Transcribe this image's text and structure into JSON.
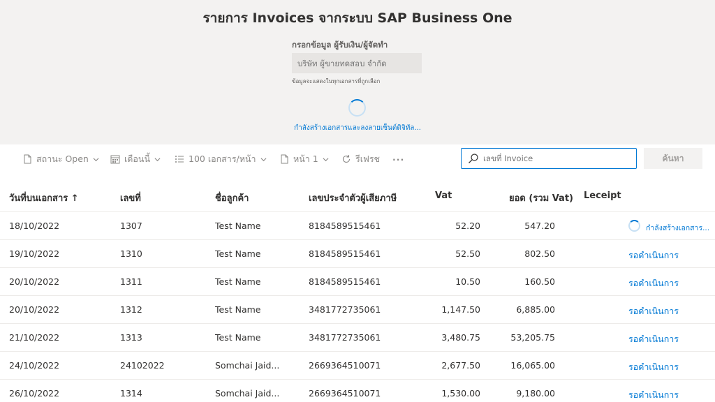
{
  "page": {
    "title": "รายการ Invoices จากระบบ SAP Business One"
  },
  "form": {
    "label": "กรอกข้อมูล ผู้รับเงิน/ผู้จัดทำ",
    "placeholder": "บริษัท ผู้ขายทดสอบ จำกัด",
    "hint": "ข้อมูลจะแสดงในทุกเอกสารที่ถูกเลือก",
    "status": "กำลังสร้างเอกสารและลงลายเซ็นต์ดิจิทัล..."
  },
  "toolbar": {
    "status_filter": "สถานะ Open",
    "date_filter": "เดือนนี้",
    "page_size": "100 เอกสาร/หน้า",
    "page": "หน้า 1",
    "refresh": "รีเฟรช",
    "more": "···",
    "search_placeholder": "เลขที่ Invoice",
    "search_button": "ค้นหา"
  },
  "table": {
    "columns": {
      "date": "วันที่บนเอกสาร ↑",
      "number": "เลขที่",
      "customer": "ชื่อลูกค้า",
      "taxid": "เลขประจำตัวผู้เสียภาษี",
      "vat": "Vat",
      "total": "ยอด (รวม Vat)",
      "receipt": "Leceipt"
    },
    "rows": [
      {
        "date": "18/10/2022",
        "number": "1307",
        "customer": "Test Name",
        "taxid": "8184589515461",
        "vat": "52.20",
        "total": "547.20",
        "receipt": "กำลังสร้างเอกสาร..."
      },
      {
        "date": "19/10/2022",
        "number": "1310",
        "customer": "Test Name",
        "taxid": "8184589515461",
        "vat": "52.50",
        "total": "802.50",
        "receipt": "รอดำเนินการ"
      },
      {
        "date": "20/10/2022",
        "number": "1311",
        "customer": "Test Name",
        "taxid": "8184589515461",
        "vat": "10.50",
        "total": "160.50",
        "receipt": "รอดำเนินการ"
      },
      {
        "date": "20/10/2022",
        "number": "1312",
        "customer": "Test Name",
        "taxid": "3481772735061",
        "vat": "1,147.50",
        "total": "6,885.00",
        "receipt": "รอดำเนินการ"
      },
      {
        "date": "21/10/2022",
        "number": "1313",
        "customer": "Test Name",
        "taxid": "3481772735061",
        "vat": "3,480.75",
        "total": "53,205.75",
        "receipt": "รอดำเนินการ"
      },
      {
        "date": "24/10/2022",
        "number": "24102022",
        "customer": "Somchai Jaid...",
        "taxid": "2669364510071",
        "vat": "2,677.50",
        "total": "16,065.00",
        "receipt": "รอดำเนินการ"
      },
      {
        "date": "26/10/2022",
        "number": "1314",
        "customer": "Somchai Jaid...",
        "taxid": "2669364510071",
        "vat": "1,530.00",
        "total": "9,180.00",
        "receipt": "รอดำเนินการ"
      }
    ]
  },
  "colors": {
    "accent": "#0078d4",
    "header_bg": "#f3f2f1"
  }
}
